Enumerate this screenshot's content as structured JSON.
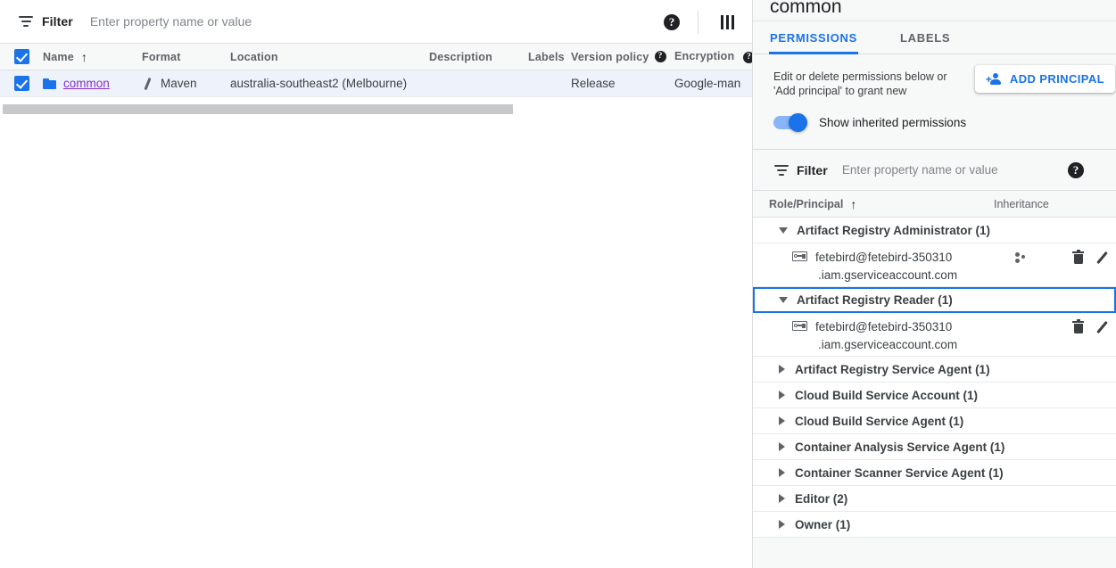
{
  "left_pane": {
    "filter": {
      "label": "Filter",
      "placeholder": "Enter property name or value",
      "value": "",
      "icon": "filter-icon"
    },
    "tools": {
      "help_icon": "help-icon",
      "help_glyph": "?",
      "columns_icon": "column-display-options-icon"
    },
    "table": {
      "columns": [
        {
          "key": "name",
          "label": "Name",
          "sorted": true,
          "sort_arrow": "↑"
        },
        {
          "key": "format",
          "label": "Format"
        },
        {
          "key": "location",
          "label": "Location"
        },
        {
          "key": "description",
          "label": "Description"
        },
        {
          "key": "labels",
          "label": "Labels"
        },
        {
          "key": "version_policy",
          "label": "Version policy",
          "help": "?"
        },
        {
          "key": "encryption",
          "label": "Encryption",
          "help": "?"
        }
      ],
      "header_checkbox_checked": true,
      "rows": [
        {
          "checked": true,
          "name": "common",
          "format": "Maven",
          "location": "australia-southeast2 (Melbourne)",
          "description": "",
          "labels": "",
          "version_policy": "Release",
          "encryption": "Google-man"
        }
      ],
      "scrollbar": "horizontal-scrollbar"
    }
  },
  "right_pane": {
    "title": "common",
    "tabs": [
      {
        "label": "PERMISSIONS",
        "active": true
      },
      {
        "label": "LABELS",
        "active": false
      }
    ],
    "description": "Edit or delete permissions below or 'Add principal' to grant new",
    "add_principal_button": "ADD PRINCIPAL",
    "inherited_toggle": {
      "label": "Show inherited permissions",
      "on": true
    },
    "filter": {
      "label": "Filter",
      "placeholder": "Enter property name or value",
      "value": "",
      "help_glyph": "?"
    },
    "table": {
      "columns": [
        {
          "key": "role_principal",
          "label": "Role/Principal",
          "sorted": true,
          "sort_arrow": "↑"
        },
        {
          "key": "inheritance",
          "label": "Inheritance"
        }
      ],
      "groups": [
        {
          "label": "Artifact Registry Administrator (1)",
          "expanded": true,
          "selected": false,
          "members": [
            {
              "line1": "fetebird@fetebird-350310",
              "line2": ".iam.gserviceaccount.com",
              "inheritance_icon": true,
              "actions": [
                "delete",
                "edit"
              ]
            }
          ]
        },
        {
          "label": "Artifact Registry Reader (1)",
          "expanded": true,
          "selected": true,
          "members": [
            {
              "line1": "fetebird@fetebird-350310",
              "line2": ".iam.gserviceaccount.com",
              "inheritance_icon": false,
              "actions": [
                "delete",
                "edit"
              ]
            }
          ]
        },
        {
          "label": "Artifact Registry Service Agent (1)",
          "expanded": false,
          "selected": false,
          "members": []
        },
        {
          "label": "Cloud Build Service Account (1)",
          "expanded": false,
          "selected": false,
          "members": []
        },
        {
          "label": "Cloud Build Service Agent (1)",
          "expanded": false,
          "selected": false,
          "members": []
        },
        {
          "label": "Container Analysis Service Agent (1)",
          "expanded": false,
          "selected": false,
          "members": []
        },
        {
          "label": "Container Scanner Service Agent (1)",
          "expanded": false,
          "selected": false,
          "members": []
        },
        {
          "label": "Editor (2)",
          "expanded": false,
          "selected": false,
          "members": []
        },
        {
          "label": "Owner (1)",
          "expanded": false,
          "selected": false,
          "members": []
        }
      ]
    }
  },
  "colors": {
    "accent_blue": "#1a73e8",
    "toggle_track": "#8ab4f8",
    "link_purple": "#8430ce",
    "panel_bg": "#f7f8f8",
    "selected_row_bg": "#eef2fb",
    "text_primary": "#202124",
    "text_secondary": "#5f6368"
  }
}
